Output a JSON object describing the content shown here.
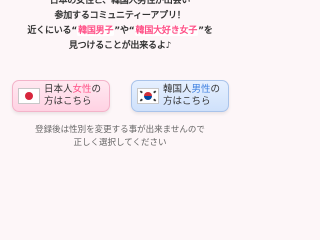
{
  "intro": {
    "line1": "日本の女性と、韓国人男性が出会い",
    "line2": "参加するコミュニティーアプリ！",
    "line3_pre": "近くにいる“",
    "line3_hl1": "韓国男子",
    "line3_mid": "”や“",
    "line3_hl2": "韓国大好き女子",
    "line3_post": "”を",
    "line4": "見つけることが出来るよ♪"
  },
  "choices": {
    "japanese_female": {
      "flag": "japan-flag-icon",
      "pre": "日本人",
      "highlight": "女性",
      "post": "の",
      "line2": "方はこちら"
    },
    "korean_male": {
      "flag": "korea-flag-icon",
      "pre": "韓国人",
      "highlight": "男性",
      "post": "の",
      "line2": "方はこちら"
    }
  },
  "note": {
    "line1": "登録後は性別を変更する事が出来ませんので",
    "line2": "正しく選択してください"
  },
  "colors": {
    "background": "#fdf6f8",
    "accent_pink": "#ff4f86",
    "accent_blue": "#3d7fe0",
    "japan_button_bg": "#ffd2e3",
    "korea_button_bg": "#cfe1fb"
  }
}
